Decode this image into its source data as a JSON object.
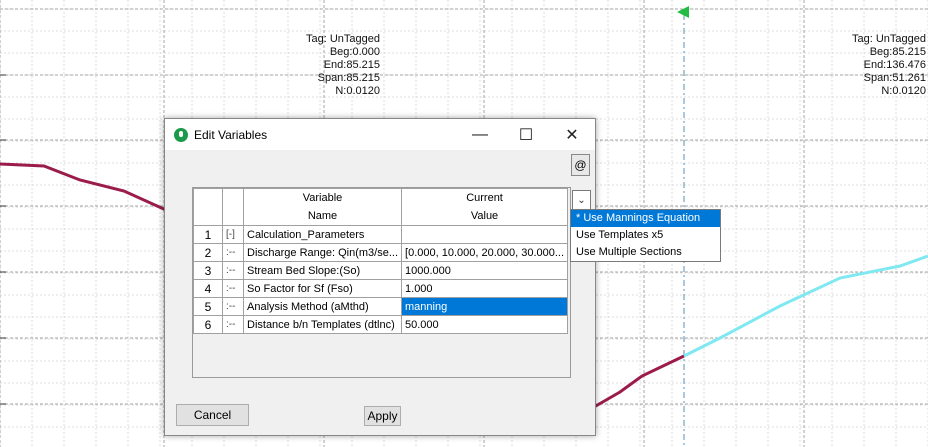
{
  "tags": [
    {
      "lines": [
        "Tag: UnTagged",
        "Beg:0.000",
        "End:85.215",
        "Span:85.215",
        "N:0.0120"
      ]
    },
    {
      "lines": [
        "Tag: UnTagged",
        "Beg:85.215",
        "End:136.476",
        "Span:51.261",
        "N:0.0120"
      ]
    }
  ],
  "colors": {
    "left_profile": "#9b1b4b",
    "right_profile": "#7fe8f0",
    "accent": "#0078d7",
    "marker": "#22bb44"
  },
  "dialog": {
    "title": "Edit Variables",
    "minimize_glyph": "—",
    "maximize_glyph": "☐",
    "close_glyph": "✕",
    "at_button": "@",
    "columns": {
      "name_line1": "Variable",
      "name_line2": "Name",
      "value_line1": "Current",
      "value_line2": "Value"
    },
    "rows": [
      {
        "num": "1",
        "toggle": "[-]",
        "name": "Calculation_Parameters",
        "value": ""
      },
      {
        "num": "2",
        "toggle": ":--",
        "name": "Discharge Range: Qin(m3/se...",
        "value": "[0.000, 10.000, 20.000, 30.000..."
      },
      {
        "num": "3",
        "toggle": ":--",
        "name": "Stream Bed Slope:(So)",
        "value": "1000.000"
      },
      {
        "num": "4",
        "toggle": ":--",
        "name": "So Factor for Sf (Fso)",
        "value": "1.000"
      },
      {
        "num": "5",
        "toggle": ":--",
        "name": "Analysis Method (aMthd)",
        "value": "manning"
      },
      {
        "num": "6",
        "toggle": ":--",
        "name": "Distance b/n Templates (dtlnc)",
        "value": "50.000"
      }
    ],
    "dropdown_button": "⌄",
    "dropdown_options": [
      "* Use Mannings Equation",
      "Use Templates x5",
      "Use Multiple Sections"
    ],
    "cancel_label": "Cancel",
    "apply_label": "Apply"
  }
}
